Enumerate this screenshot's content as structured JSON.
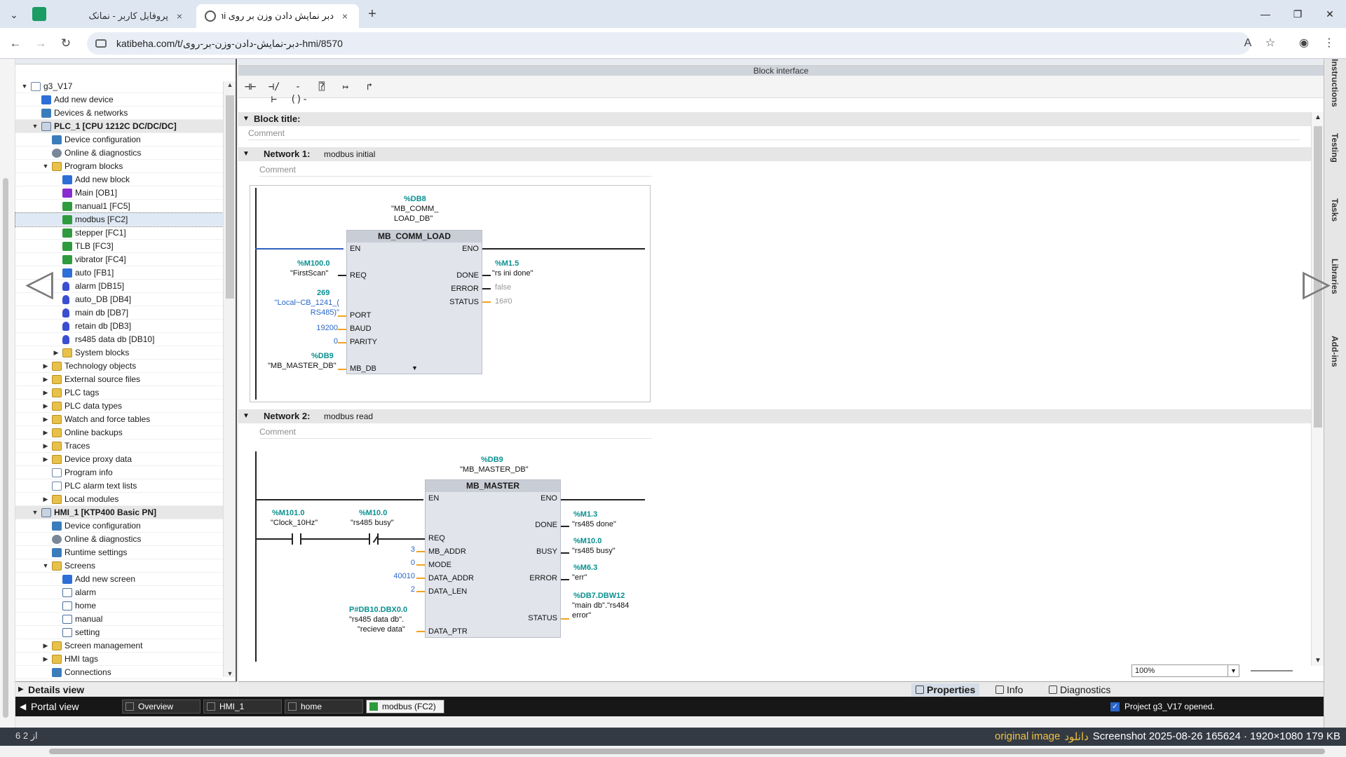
{
  "browser": {
    "tabs": [
      {
        "title": "پروفایل کاربر - نمانک"
      },
      {
        "title": "دبر نمایش دادن وزن بر روی hmi"
      }
    ],
    "url": "katibeha.com/t/دبر-نمایش-دادن-وزن-بر-روی-hmi/8570"
  },
  "tree": {
    "rows": [
      {
        "label": "g3_V17",
        "level": 0,
        "twisty": "▼",
        "icon": "doc",
        "kind": "normal"
      },
      {
        "label": "Add new device",
        "level": 1,
        "twisty": "",
        "icon": "blue",
        "kind": "normal"
      },
      {
        "label": "Devices & networks",
        "level": 1,
        "twisty": "",
        "icon": "netw",
        "kind": "normal"
      },
      {
        "label": "PLC_1 [CPU 1212C DC/DC/DC]",
        "level": 1,
        "twisty": "▼",
        "icon": "cpu",
        "kind": "device"
      },
      {
        "label": "Device configuration",
        "level": 2,
        "twisty": "",
        "icon": "netw",
        "kind": "normal"
      },
      {
        "label": "Online & diagnostics",
        "level": 2,
        "twisty": "",
        "icon": "gear",
        "kind": "normal"
      },
      {
        "label": "Program blocks",
        "level": 2,
        "twisty": "▼",
        "icon": "folder",
        "kind": "normal"
      },
      {
        "label": "Add new block",
        "level": 3,
        "twisty": "",
        "icon": "blue",
        "kind": "normal"
      },
      {
        "label": "Main [OB1]",
        "level": 3,
        "twisty": "",
        "icon": "purple",
        "kind": "normal"
      },
      {
        "label": "manual1 [FC5]",
        "level": 3,
        "twisty": "",
        "icon": "green",
        "kind": "normal"
      },
      {
        "label": "modbus [FC2]",
        "level": 3,
        "twisty": "",
        "icon": "green",
        "kind": "selected"
      },
      {
        "label": "stepper [FC1]",
        "level": 3,
        "twisty": "",
        "icon": "green",
        "kind": "normal"
      },
      {
        "label": "TLB [FC3]",
        "level": 3,
        "twisty": "",
        "icon": "green",
        "kind": "normal"
      },
      {
        "label": "vibrator [FC4]",
        "level": 3,
        "twisty": "",
        "icon": "green",
        "kind": "normal"
      },
      {
        "label": "auto [FB1]",
        "level": 3,
        "twisty": "",
        "icon": "blue",
        "kind": "normal"
      },
      {
        "label": "alarm [DB15]",
        "level": 3,
        "twisty": "",
        "icon": "db",
        "kind": "normal"
      },
      {
        "label": "auto_DB [DB4]",
        "level": 3,
        "twisty": "",
        "icon": "db",
        "kind": "normal"
      },
      {
        "label": "main db [DB7]",
        "level": 3,
        "twisty": "",
        "icon": "db",
        "kind": "normal"
      },
      {
        "label": "retain db [DB3]",
        "level": 3,
        "twisty": "",
        "icon": "db",
        "kind": "normal"
      },
      {
        "label": "rs485 data db [DB10]",
        "level": 3,
        "twisty": "",
        "icon": "db",
        "kind": "normal"
      },
      {
        "label": "System blocks",
        "level": 3,
        "twisty": "▶",
        "icon": "folder",
        "kind": "normal"
      },
      {
        "label": "Technology objects",
        "level": 2,
        "twisty": "▶",
        "icon": "folder",
        "kind": "normal"
      },
      {
        "label": "External source files",
        "level": 2,
        "twisty": "▶",
        "icon": "folder",
        "kind": "normal"
      },
      {
        "label": "PLC tags",
        "level": 2,
        "twisty": "▶",
        "icon": "folder",
        "kind": "normal"
      },
      {
        "label": "PLC data types",
        "level": 2,
        "twisty": "▶",
        "icon": "folder",
        "kind": "normal"
      },
      {
        "label": "Watch and force tables",
        "level": 2,
        "twisty": "▶",
        "icon": "folder",
        "kind": "normal"
      },
      {
        "label": "Online backups",
        "level": 2,
        "twisty": "▶",
        "icon": "folder",
        "kind": "normal"
      },
      {
        "label": "Traces",
        "level": 2,
        "twisty": "▶",
        "icon": "folder",
        "kind": "normal"
      },
      {
        "label": "Device proxy data",
        "level": 2,
        "twisty": "▶",
        "icon": "folder",
        "kind": "normal"
      },
      {
        "label": "Program info",
        "level": 2,
        "twisty": "",
        "icon": "doc",
        "kind": "normal"
      },
      {
        "label": "PLC alarm text lists",
        "level": 2,
        "twisty": "",
        "icon": "doc",
        "kind": "normal"
      },
      {
        "label": "Local modules",
        "level": 2,
        "twisty": "▶",
        "icon": "folder",
        "kind": "normal"
      },
      {
        "label": "HMI_1 [KTP400 Basic PN]",
        "level": 1,
        "twisty": "▼",
        "icon": "cpu",
        "kind": "device"
      },
      {
        "label": "Device configuration",
        "level": 2,
        "twisty": "",
        "icon": "netw",
        "kind": "normal"
      },
      {
        "label": "Online & diagnostics",
        "level": 2,
        "twisty": "",
        "icon": "gear",
        "kind": "normal"
      },
      {
        "label": "Runtime settings",
        "level": 2,
        "twisty": "",
        "icon": "netw",
        "kind": "normal"
      },
      {
        "label": "Screens",
        "level": 2,
        "twisty": "▼",
        "icon": "folder",
        "kind": "normal"
      },
      {
        "label": "Add new screen",
        "level": 3,
        "twisty": "",
        "icon": "blue",
        "kind": "normal"
      },
      {
        "label": "alarm",
        "level": 3,
        "twisty": "",
        "icon": "screen",
        "kind": "normal"
      },
      {
        "label": "home",
        "level": 3,
        "twisty": "",
        "icon": "screen",
        "kind": "normal"
      },
      {
        "label": "manual",
        "level": 3,
        "twisty": "",
        "icon": "screen",
        "kind": "normal"
      },
      {
        "label": "setting",
        "level": 3,
        "twisty": "",
        "icon": "screen",
        "kind": "normal"
      },
      {
        "label": "Screen management",
        "level": 2,
        "twisty": "▶",
        "icon": "folder",
        "kind": "normal"
      },
      {
        "label": "HMI tags",
        "level": 2,
        "twisty": "▶",
        "icon": "folder",
        "kind": "normal"
      },
      {
        "label": "Connections",
        "level": 2,
        "twisty": "",
        "icon": "netw",
        "kind": "normal"
      }
    ],
    "details_view": "Details view"
  },
  "editor": {
    "block_interface": "Block interface",
    "block_title_label": "Block title:",
    "comment_placeholder": "Comment",
    "network1": {
      "label": "Network 1:",
      "title": "modbus initial",
      "instance_addr": "%DB8",
      "instance_name_1": "\"MB_COMM_",
      "instance_name_2": "LOAD_DB\"",
      "block_name": "MB_COMM_LOAD",
      "pin_en": "EN",
      "pin_eno": "ENO",
      "pin_req": "REQ",
      "pin_port": "PORT",
      "pin_baud": "BAUD",
      "pin_parity": "PARITY",
      "pin_mbdb": "MB_DB",
      "pin_done": "DONE",
      "pin_error": "ERROR",
      "pin_status": "STATUS",
      "req_addr": "%M100.0",
      "req_sym": "\"FirstScan\"",
      "port_val": "269",
      "port_sym_1": "\"Local~CB_1241_(",
      "port_sym_2": "RS485)\"",
      "baud_val": "19200",
      "parity_val": "0",
      "mbdb_addr": "%DB9",
      "mbdb_sym": "\"MB_MASTER_DB\"",
      "done_addr": "%M1.5",
      "done_sym": "\"rs ini done\"",
      "error_val": "false",
      "status_val": "16#0"
    },
    "network2": {
      "label": "Network 2:",
      "title": "modbus read",
      "instance_addr": "%DB9",
      "instance_name": "\"MB_MASTER_DB\"",
      "block_name": "MB_MASTER",
      "pin_en": "EN",
      "pin_eno": "ENO",
      "pin_req": "REQ",
      "pin_mbaddr": "MB_ADDR",
      "pin_mode": "MODE",
      "pin_dataaddr": "DATA_ADDR",
      "pin_datalen": "DATA_LEN",
      "pin_dataptr": "DATA_PTR",
      "pin_done": "DONE",
      "pin_busy": "BUSY",
      "pin_error": "ERROR",
      "pin_status": "STATUS",
      "c1_addr": "%M101.0",
      "c1_sym": "\"Clock_10Hz\"",
      "c2_addr": "%M10.0",
      "c2_sym": "\"rs485 busy\"",
      "mbaddr_val": "3",
      "mode_val": "0",
      "dataaddr_val": "40010",
      "datalen_val": "2",
      "dataptr_addr": "P#DB10.DBX0.0",
      "dataptr_sym_1": "\"rs485 data db\".",
      "dataptr_sym_2": "\"recieve data\"",
      "done_addr": "%M1.3",
      "done_sym": "\"rs485 done\"",
      "busy_addr": "%M10.0",
      "busy_sym": "\"rs485 busy\"",
      "error_addr": "%M6.3",
      "error_sym": "\"err\"",
      "status_addr": "%DB7.DBW12",
      "status_sym_1": "\"main db\".\"rs484",
      "status_sym_2": "error\""
    },
    "zoom": "100%"
  },
  "right_tabs": [
    "Instructions",
    "Testing",
    "Tasks",
    "Libraries",
    "Add-ins"
  ],
  "props": {
    "properties": "Properties",
    "info": "Info",
    "diagnostics": "Diagnostics"
  },
  "portal": {
    "portal_view": "Portal view",
    "tasks": [
      "Overview",
      "HMI_1",
      "home",
      "modbus (FC2)"
    ],
    "status": "Project g3_V17 opened."
  },
  "footer": {
    "counter": "6 از 2",
    "original_image": "original image",
    "download": "دانلود",
    "screenshot_info": "Screenshot 2025-08-26 165624 · 1920×1080 179 KB"
  }
}
